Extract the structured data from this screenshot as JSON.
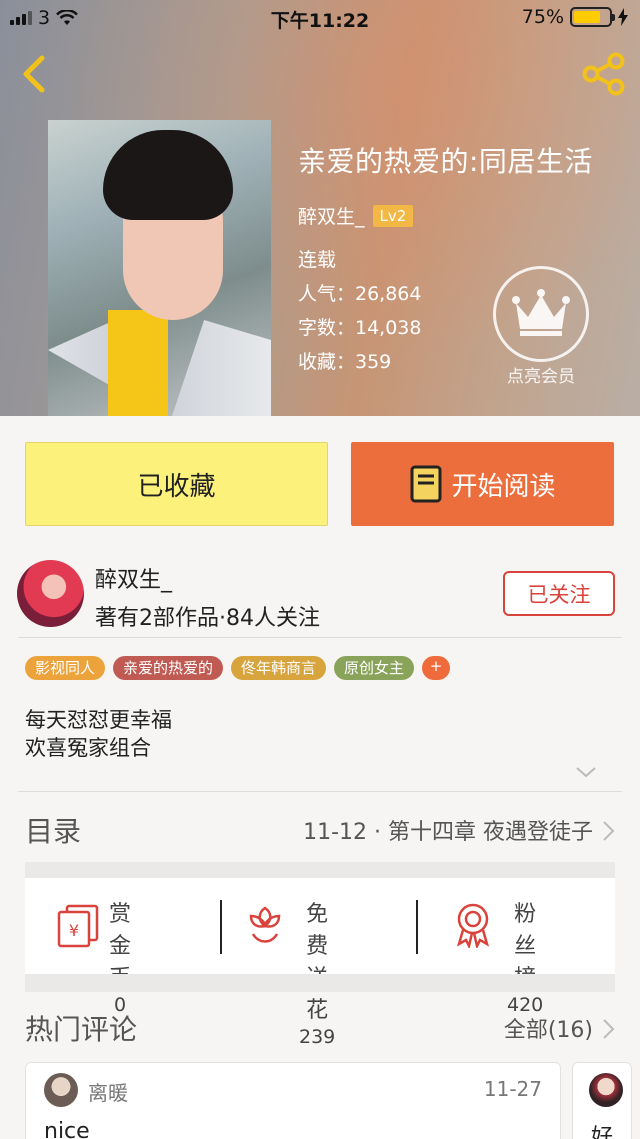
{
  "status_bar": {
    "carrier": "3",
    "time": "下午11:22",
    "battery": "75%",
    "battery_level": 0.75
  },
  "book": {
    "title": "亲爱的热爱的:同居生活",
    "author": "醉双生_",
    "level": "Lv2",
    "status": "连载",
    "popularity": "人气：26,864",
    "words": "字数：14,038",
    "favorites": "收藏：359"
  },
  "vip": {
    "label": "点亮会员"
  },
  "actions": {
    "favorite_label": "已收藏",
    "read_label": "开始阅读"
  },
  "author_card": {
    "name": "醉双生_",
    "stats": "著有2部作品·84人关注",
    "follow_label": "已关注"
  },
  "tags": [
    {
      "label": "影视同人",
      "color": "#eda33b"
    },
    {
      "label": "亲爱的热爱的",
      "color": "#c05b53"
    },
    {
      "label": "佟年韩商言",
      "color": "#d7a43e"
    },
    {
      "label": "原创女主",
      "color": "#8aa35a"
    },
    {
      "label": "+",
      "color": "#ef6b3b"
    }
  ],
  "description": {
    "line1": "每天怼怼更幸福",
    "line2": "欢喜冤家组合"
  },
  "toc": {
    "label": "目录",
    "latest": "11-12 · 第十四章 夜遇登徒子"
  },
  "stats": [
    {
      "name": "赏金币",
      "value": "0"
    },
    {
      "name": "免费送花",
      "value": "239"
    },
    {
      "name": "粉丝榜",
      "value": "420"
    }
  ],
  "comments_section": {
    "label": "热门评论",
    "all": "全部(16)"
  },
  "comments": [
    {
      "user": "离暖",
      "date": "11-27",
      "text": "nice"
    },
    {
      "text": "好"
    }
  ],
  "colors": {
    "accent_orange": "#ec6e3c",
    "fav_yellow": "#fcf17a",
    "follow_red": "#d9433b"
  }
}
